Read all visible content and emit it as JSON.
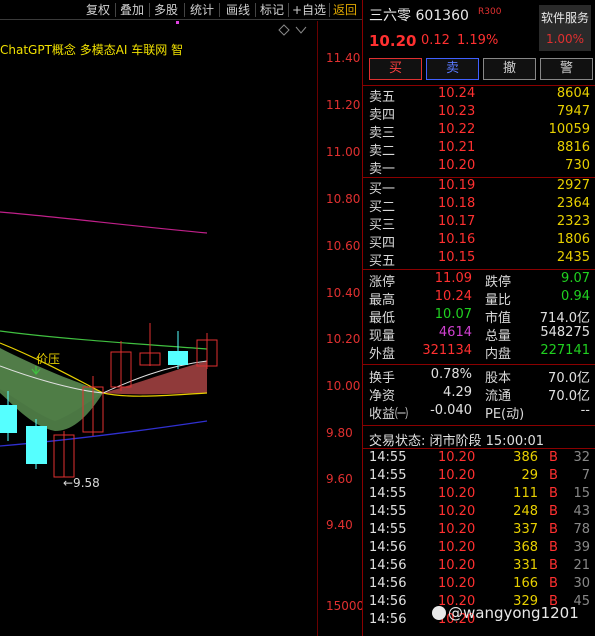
{
  "toolbar": {
    "items": [
      "复权",
      "叠加",
      "多股",
      "统计",
      "画线",
      "标记",
      "+自选"
    ],
    "return_label": "返回"
  },
  "chart": {
    "concepts": "ChatGPT概念  多模态AI  车联网  智",
    "y_labels": [
      "11.40",
      "11.20",
      "11.00",
      "10.80",
      "10.60",
      "10.40",
      "10.20",
      "10.00",
      "9.80",
      "9.60",
      "9.40",
      "15000"
    ],
    "annotation_price_press": "价压",
    "annotation_low": "←9.58",
    "colors": {
      "up": "#e03030",
      "down": "#5ff",
      "ma_purple": "#c0208a",
      "ma_green": "#40c040",
      "ma_blue": "#3030c0",
      "ma_yellow": "#e8d000"
    }
  },
  "quote": {
    "name": "三六零 601360",
    "tag": "R300",
    "service_label": "软件服务",
    "service_pct": "1.00%",
    "price": "10.20",
    "change": "0.12",
    "change_pct": "1.19%",
    "buttons": {
      "buy": "买",
      "sell": "卖",
      "cancel": "撤",
      "warn": "警"
    }
  },
  "asks": [
    {
      "label": "卖五",
      "price": "10.24",
      "vol": "8604"
    },
    {
      "label": "卖四",
      "price": "10.23",
      "vol": "7947"
    },
    {
      "label": "卖三",
      "price": "10.22",
      "vol": "10059"
    },
    {
      "label": "卖二",
      "price": "10.21",
      "vol": "8816"
    },
    {
      "label": "卖一",
      "price": "10.20",
      "vol": "730"
    }
  ],
  "bids": [
    {
      "label": "买一",
      "price": "10.19",
      "vol": "2927"
    },
    {
      "label": "买二",
      "price": "10.18",
      "vol": "2364"
    },
    {
      "label": "买三",
      "price": "10.17",
      "vol": "2323"
    },
    {
      "label": "买四",
      "price": "10.16",
      "vol": "1806"
    },
    {
      "label": "买五",
      "price": "10.15",
      "vol": "2435"
    }
  ],
  "stats1": [
    {
      "k1": "涨停",
      "v1": "11.09",
      "c1": "red",
      "k2": "跌停",
      "v2": "9.07",
      "c2": "green"
    },
    {
      "k1": "最高",
      "v1": "10.24",
      "c1": "red",
      "k2": "量比",
      "v2": "0.94",
      "c2": "green"
    },
    {
      "k1": "最低",
      "v1": "10.07",
      "c1": "green",
      "k2": "市值",
      "v2": "714.0亿",
      "c2": "white"
    },
    {
      "k1": "现量",
      "v1": "4614",
      "c1": "purple",
      "k2": "总量",
      "v2": "548275",
      "c2": "white"
    },
    {
      "k1": "外盘",
      "v1": "321134",
      "c1": "red",
      "k2": "内盘",
      "v2": "227141",
      "c2": "green"
    }
  ],
  "stats2": [
    {
      "k1": "换手",
      "v1": "0.78%",
      "c1": "white",
      "k2": "股本",
      "v2": "70.0亿",
      "c2": "white"
    },
    {
      "k1": "净资",
      "v1": "4.29",
      "c1": "white",
      "k2": "流通",
      "v2": "70.0亿",
      "c2": "white"
    },
    {
      "k1": "收益㈠",
      "v1": "-0.040",
      "c1": "white",
      "k2": "PE(动)",
      "v2": "--",
      "c2": "white"
    }
  ],
  "trade_status": "交易状态: 闭市阶段 15:00:01",
  "ticks": [
    {
      "time": "14:55",
      "price": "10.20",
      "vol": "386",
      "side": "B",
      "n": "32"
    },
    {
      "time": "14:55",
      "price": "10.20",
      "vol": "29",
      "side": "B",
      "n": "7"
    },
    {
      "time": "14:55",
      "price": "10.20",
      "vol": "111",
      "side": "B",
      "n": "15"
    },
    {
      "time": "14:55",
      "price": "10.20",
      "vol": "248",
      "side": "B",
      "n": "43"
    },
    {
      "time": "14:55",
      "price": "10.20",
      "vol": "337",
      "side": "B",
      "n": "78"
    },
    {
      "time": "14:56",
      "price": "10.20",
      "vol": "368",
      "side": "B",
      "n": "39"
    },
    {
      "time": "14:56",
      "price": "10.20",
      "vol": "331",
      "side": "B",
      "n": "21"
    },
    {
      "time": "14:56",
      "price": "10.20",
      "vol": "166",
      "side": "B",
      "n": "30"
    },
    {
      "time": "14:56",
      "price": "10.20",
      "vol": "329",
      "side": "B",
      "n": "45"
    },
    {
      "time": "14:56",
      "price": "10.20",
      "vol": "",
      "side": "",
      "n": ""
    }
  ],
  "watermark": "@wangyong1201"
}
